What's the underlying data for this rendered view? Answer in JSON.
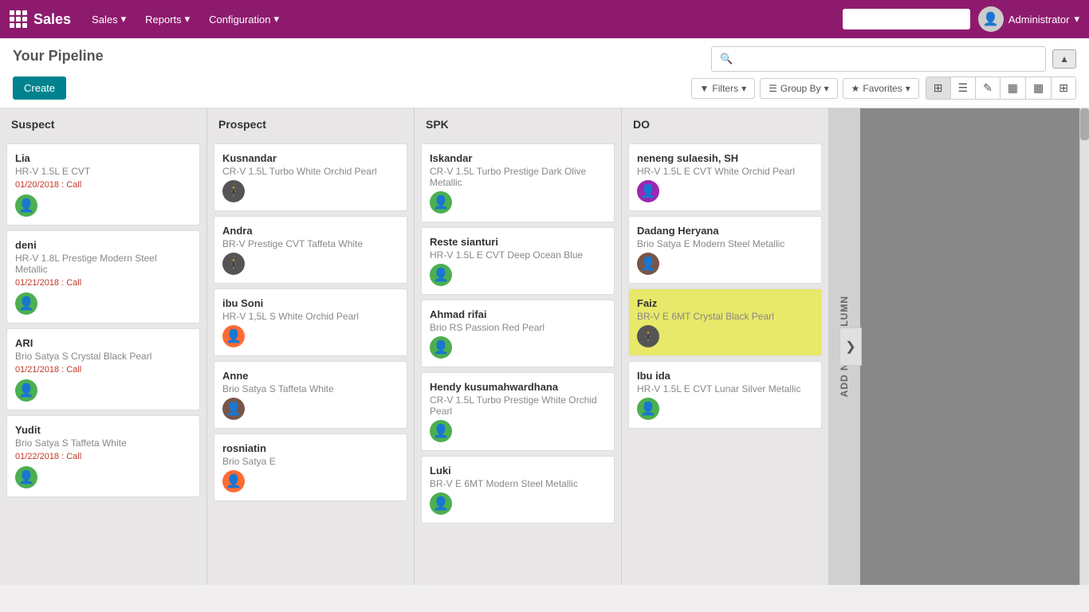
{
  "app": {
    "name": "Sales",
    "grid_icon": "grid-icon"
  },
  "topnav": {
    "menus": [
      {
        "label": "Sales",
        "has_dropdown": true
      },
      {
        "label": "Reports",
        "has_dropdown": true
      },
      {
        "label": "Configuration",
        "has_dropdown": true
      }
    ],
    "admin_label": "Administrator",
    "dropdown_arrow": "▾"
  },
  "page": {
    "title": "Your Pipeline",
    "create_btn": "Create"
  },
  "search": {
    "placeholder": "",
    "filters_label": "Filters",
    "groupby_label": "Group By",
    "favorites_label": "Favorites",
    "filter_icon": "▼",
    "groupby_icon": "☰",
    "favorites_icon": "★"
  },
  "views": {
    "kanban_icon": "⊞",
    "list_icon": "☰",
    "edit_icon": "✎",
    "chart_icon": "▦",
    "calendar_icon": "▦",
    "grid_icon": "▦"
  },
  "columns": [
    {
      "id": "suspect",
      "label": "Suspect",
      "cards": [
        {
          "id": "c1",
          "name": "Lia",
          "product": "HR-V 1.5L E CVT",
          "date": "01/20/2018 : Call",
          "avatar_type": "green",
          "avatar_char": "👤"
        },
        {
          "id": "c2",
          "name": "deni",
          "product": "HR-V 1.8L Prestige Modern Steel Metallic",
          "date": "01/21/2018 : Call",
          "avatar_type": "green",
          "avatar_char": "👤"
        },
        {
          "id": "c3",
          "name": "ARI",
          "product": "Brio Satya S Crystal Black Pearl",
          "date": "01/21/2018 : Call",
          "avatar_type": "green",
          "avatar_char": "👤"
        },
        {
          "id": "c4",
          "name": "Yudit",
          "product": "Brio Satya S Taffeta White",
          "date": "01/22/2018 : Call",
          "avatar_type": "green",
          "avatar_char": "👤"
        }
      ]
    },
    {
      "id": "prospect",
      "label": "Prospect",
      "cards": [
        {
          "id": "c5",
          "name": "Kusnandar",
          "product": "CR-V 1.5L Turbo White Orchid Pearl",
          "date": "",
          "avatar_type": "suit",
          "avatar_char": "🧑"
        },
        {
          "id": "c6",
          "name": "Andra",
          "product": "BR-V Prestige CVT Taffeta White",
          "date": "",
          "avatar_type": "suit",
          "avatar_char": "🧑"
        },
        {
          "id": "c7",
          "name": "ibu Soni",
          "product": "HR-V 1,5L S White Orchid Pearl",
          "date": "",
          "avatar_type": "orange",
          "avatar_char": "👩"
        },
        {
          "id": "c8",
          "name": "Anne",
          "product": "Brio Satya S Taffeta White",
          "date": "",
          "avatar_type": "mixed",
          "avatar_char": "👤"
        },
        {
          "id": "c9",
          "name": "rosniatin",
          "product": "Brio Satya E",
          "date": "",
          "avatar_type": "orange",
          "avatar_char": "👩"
        }
      ]
    },
    {
      "id": "spk",
      "label": "SPK",
      "cards": [
        {
          "id": "c10",
          "name": "Iskandar",
          "product": "CR-V 1.5L Turbo Prestige Dark Olive Metallic",
          "date": "",
          "avatar_type": "green",
          "avatar_char": "👤"
        },
        {
          "id": "c11",
          "name": "Reste sianturi",
          "product": "HR-V 1.5L E CVT Deep Ocean Blue",
          "date": "",
          "avatar_type": "green",
          "avatar_char": "👤"
        },
        {
          "id": "c12",
          "name": "Ahmad rifai",
          "product": "Brio RS Passion Red Pearl",
          "date": "",
          "avatar_type": "green",
          "avatar_char": "👤"
        },
        {
          "id": "c13",
          "name": "Hendy kusumahwardhana",
          "product": "CR-V 1.5L Turbo Prestige White Orchid Pearl",
          "date": "",
          "avatar_type": "green",
          "avatar_char": "👤"
        },
        {
          "id": "c14",
          "name": "Luki",
          "product": "BR-V E 6MT Modern Steel Metallic",
          "date": "",
          "avatar_type": "green",
          "avatar_char": "👤"
        }
      ]
    },
    {
      "id": "do",
      "label": "DO",
      "cards": [
        {
          "id": "c15",
          "name": "neneng sulaesih, SH",
          "product": "HR-V 1.5L E CVT White Orchid Pearl",
          "date": "",
          "avatar_type": "purple",
          "avatar_char": "👩",
          "highlighted": false
        },
        {
          "id": "c16",
          "name": "Dadang Heryana",
          "product": "Brio Satya E Modern Steel Metallic",
          "date": "",
          "avatar_type": "mixed",
          "avatar_char": "👤",
          "highlighted": false
        },
        {
          "id": "c17",
          "name": "Faiz",
          "product": "BR-V E 6MT Crystal Black Pearl",
          "date": "",
          "avatar_type": "suit",
          "avatar_char": "🧑",
          "highlighted": true
        },
        {
          "id": "c18",
          "name": "Ibu ida",
          "product": "HR-V 1.5L E CVT Lunar Silver Metallic",
          "date": "",
          "avatar_type": "green",
          "avatar_char": "👤",
          "highlighted": false
        }
      ]
    }
  ],
  "add_new_column_label": "ADD NEW COLUMN",
  "chevron_label": "❯"
}
